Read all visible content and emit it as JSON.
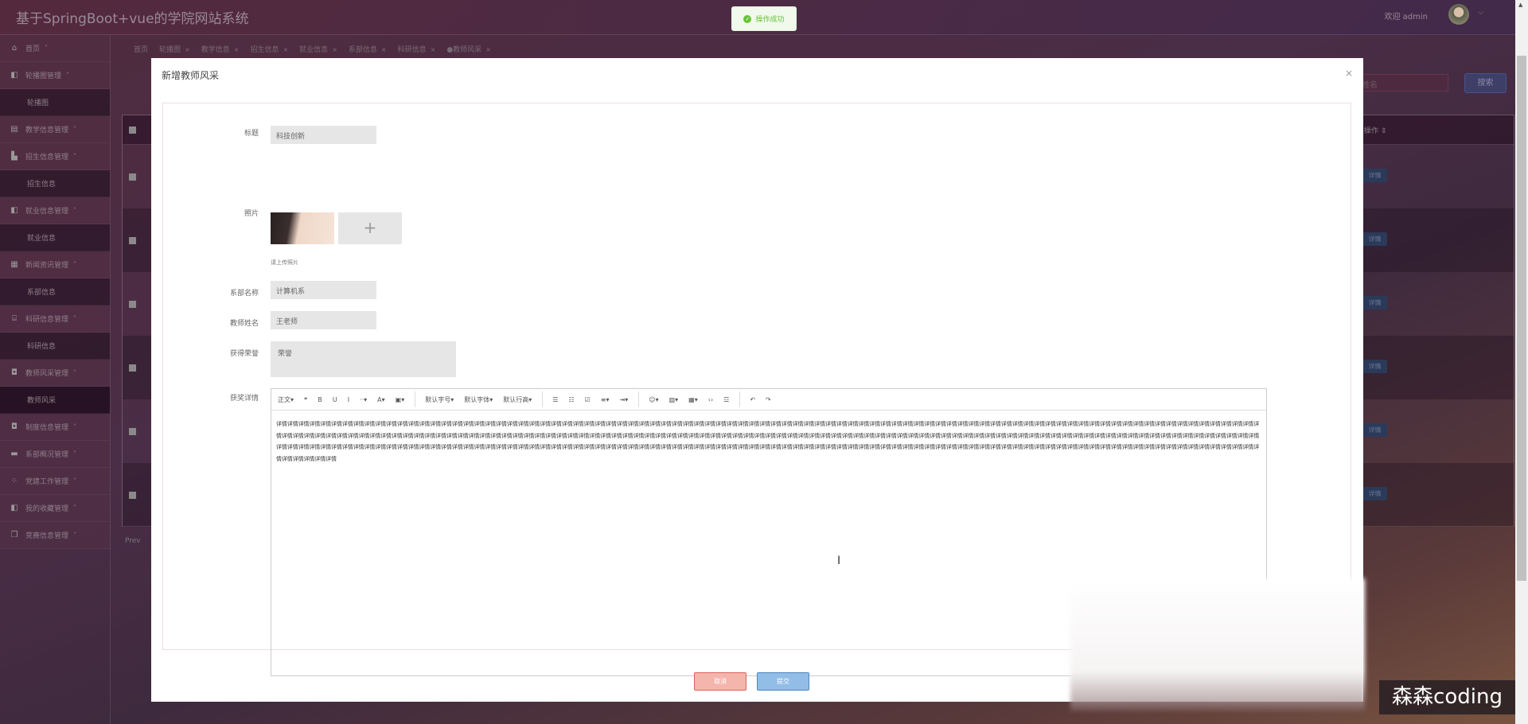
{
  "header": {
    "title": "基于SpringBoot+vue的学院网站系统",
    "welcome": "欢迎 admin"
  },
  "toast": {
    "message": "操作成功"
  },
  "sidebar": {
    "items": [
      {
        "label": "首页",
        "icon": "home-icon",
        "caret": "˅",
        "sub": false
      },
      {
        "label": "轮播图管理",
        "icon": "panel-icon",
        "caret": "˄",
        "sub": false
      },
      {
        "label": "轮播图",
        "sub": true
      },
      {
        "label": "教学信息管理",
        "icon": "list-icon",
        "caret": "˅",
        "sub": false
      },
      {
        "label": "招生信息管理",
        "icon": "chart-icon",
        "caret": "˄",
        "sub": false
      },
      {
        "label": "招生信息",
        "sub": true
      },
      {
        "label": "就业信息管理",
        "icon": "panel-icon",
        "caret": "˄",
        "sub": false
      },
      {
        "label": "就业信息",
        "sub": true
      },
      {
        "label": "新闻资讯管理",
        "icon": "grid-icon",
        "caret": "˄",
        "sub": false
      },
      {
        "label": "系部信息",
        "sub": true
      },
      {
        "label": "科研信息管理",
        "icon": "briefcase-icon",
        "caret": "˄",
        "sub": false
      },
      {
        "label": "科研信息",
        "sub": true
      },
      {
        "label": "教师风采管理",
        "icon": "chip-icon",
        "caret": "˄",
        "sub": false
      },
      {
        "label": "教师风采",
        "sub": true,
        "active": true
      },
      {
        "label": "制度信息管理",
        "icon": "chip-icon",
        "caret": "˅",
        "sub": false
      },
      {
        "label": "系部概况管理",
        "icon": "ticket-icon",
        "caret": "˅",
        "sub": false
      },
      {
        "label": "党建工作管理",
        "icon": "apps-icon",
        "caret": "˅",
        "sub": false
      },
      {
        "label": "我的收藏管理",
        "icon": "panel-icon",
        "caret": "˅",
        "sub": false
      },
      {
        "label": "竞赛信息管理",
        "icon": "copy-icon",
        "caret": "˅",
        "sub": false
      }
    ]
  },
  "tabs": [
    {
      "label": "首页"
    },
    {
      "label": "轮播图",
      "close": "×"
    },
    {
      "label": "教学信息",
      "close": "×"
    },
    {
      "label": "招生信息",
      "close": "×"
    },
    {
      "label": "就业信息",
      "close": "×"
    },
    {
      "label": "系部信息",
      "close": "×"
    },
    {
      "label": "科研信息",
      "close": "×"
    },
    {
      "label": "●教师风采",
      "close": "×"
    }
  ],
  "search": {
    "placeholder": "姓名",
    "button": "搜索"
  },
  "table": {
    "op_header": "操作 ⇕",
    "detail": "详情",
    "prev": "Prev"
  },
  "modal": {
    "title": "新增教师风采",
    "close": "×",
    "fields": {
      "title_label": "标题",
      "title_value": "科技创新",
      "photo_label": "照片",
      "photo_plus": "+",
      "photo_hint": "请上传照片",
      "dept_label": "系部名称",
      "dept_value": "计算机系",
      "teacher_label": "教师姓名",
      "teacher_value": "王老师",
      "honor_label": "获得荣誉",
      "honor_value": "荣誉",
      "detail_label": "获奖详情"
    },
    "toolbar": [
      "正文▾",
      "❝",
      "B",
      "U",
      "I",
      "··▾",
      "A▾",
      "▣▾",
      "|",
      "默认字号▾",
      "默认字体▾",
      "默认行高▾",
      "|",
      "☰",
      "☷",
      "☑",
      "≡▾",
      "⇥▾",
      "|",
      "☺▾",
      "▨▾",
      "▦▾",
      "‹›",
      "☲",
      "|",
      "↶",
      "↷"
    ],
    "editor_content": "详情详情详情详情详情详情详情详情详情详情详情详情详情详情详情详情详情详情详情详情详情详情详情详情详情详情详情详情详情详情详情详情详情详情详情详情详情详情详情详情详情详情详情详情详情详情详情详情详情详情详情详情详情详情详情详情详情详情详情详情详情详情详情详情详情详情详情详情详情详情详情详情详情详情详情详情详情详情详情详情详情详情详情详情详情详情详情详情详情详情详情详情详情详情详情详情详情详情详情详情详情详情详情详情详情详情详情详情详情详情详情详情详情详情详情详情详情详情详情详情详情详情详情详情详情详情详情详情详情详情详情详情详情详情详情详情详情详情详情详情详情详情详情详情详情详情详情详情详情详情详情详情详情详情详情详情详情详情详情详情详情详情详情详情详情详情详情详情详情详情详情详情详情详情详情详情详情详情详情详情详情详情详情详情详情详情详情详情详情详情详情详情详情详情详情详情详情详情详情详情详情详情详情详情详情详情详情详情详情详情详情详情详情详情详情详情详情详情详情详情详情详情详情详情详情详情详情详情详情详情详情详情详情详情详情详情详情详情详情详情详情详情详情详情详情详情详情详情详情详情详情详情详情详情详情详情详情详情详情详情详情详情详情详情详情详情详情详情详情详情详情详情详情详情",
    "cancel": "取消",
    "submit": "提交"
  },
  "watermark": "森森coding"
}
